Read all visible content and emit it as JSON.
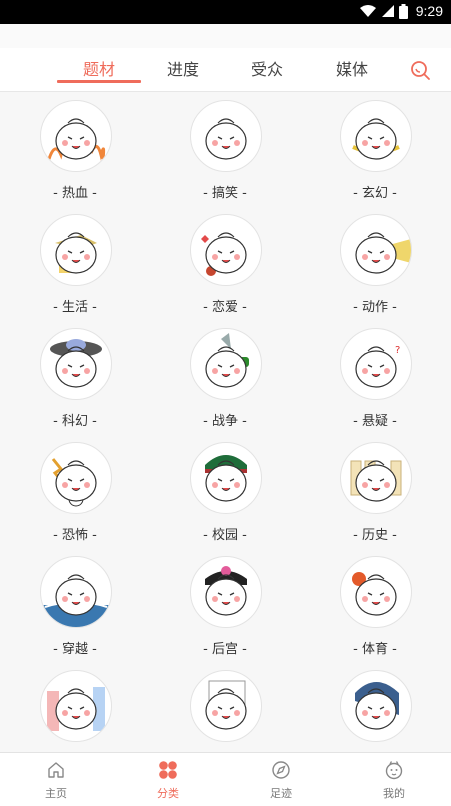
{
  "status_bar": {
    "time": "9:29"
  },
  "tabs": [
    {
      "label": "题材",
      "active": true
    },
    {
      "label": "进度",
      "active": false
    },
    {
      "label": "受众",
      "active": false
    },
    {
      "label": "媒体",
      "active": false
    }
  ],
  "accent_color": "#ef6c5b",
  "categories": [
    {
      "label": "- 热血 -",
      "icon": "fire-mascot-icon"
    },
    {
      "label": "- 搞笑 -",
      "icon": "laughing-mascot-icon"
    },
    {
      "label": "- 玄幻 -",
      "icon": "magic-mascot-icon"
    },
    {
      "label": "- 生活 -",
      "icon": "life-mascot-icon"
    },
    {
      "label": "- 恋爱 -",
      "icon": "love-mascot-icon"
    },
    {
      "label": "- 动作 -",
      "icon": "action-mascot-icon"
    },
    {
      "label": "- 科幻 -",
      "icon": "ufo-mascot-icon"
    },
    {
      "label": "- 战争 -",
      "icon": "war-mascot-icon"
    },
    {
      "label": "- 悬疑 -",
      "icon": "mystery-mascot-icon"
    },
    {
      "label": "- 恐怖 -",
      "icon": "horror-mascot-icon"
    },
    {
      "label": "- 校园 -",
      "icon": "campus-mascot-icon"
    },
    {
      "label": "- 历史 -",
      "icon": "history-mascot-icon"
    },
    {
      "label": "- 穿越 -",
      "icon": "time-travel-mascot-icon"
    },
    {
      "label": "- 后宫 -",
      "icon": "harem-mascot-icon"
    },
    {
      "label": "- 体育 -",
      "icon": "sports-mascot-icon"
    },
    {
      "label": "",
      "icon": "city-mascot-icon"
    },
    {
      "label": "",
      "icon": "book-mascot-icon"
    },
    {
      "label": "",
      "icon": "blue-hair-mascot-icon"
    }
  ],
  "bottom_nav": [
    {
      "label": "主页",
      "icon": "home-icon",
      "active": false
    },
    {
      "label": "分类",
      "icon": "category-icon",
      "active": true
    },
    {
      "label": "足迹",
      "icon": "compass-icon",
      "active": false
    },
    {
      "label": "我的",
      "icon": "profile-icon",
      "active": false
    }
  ]
}
